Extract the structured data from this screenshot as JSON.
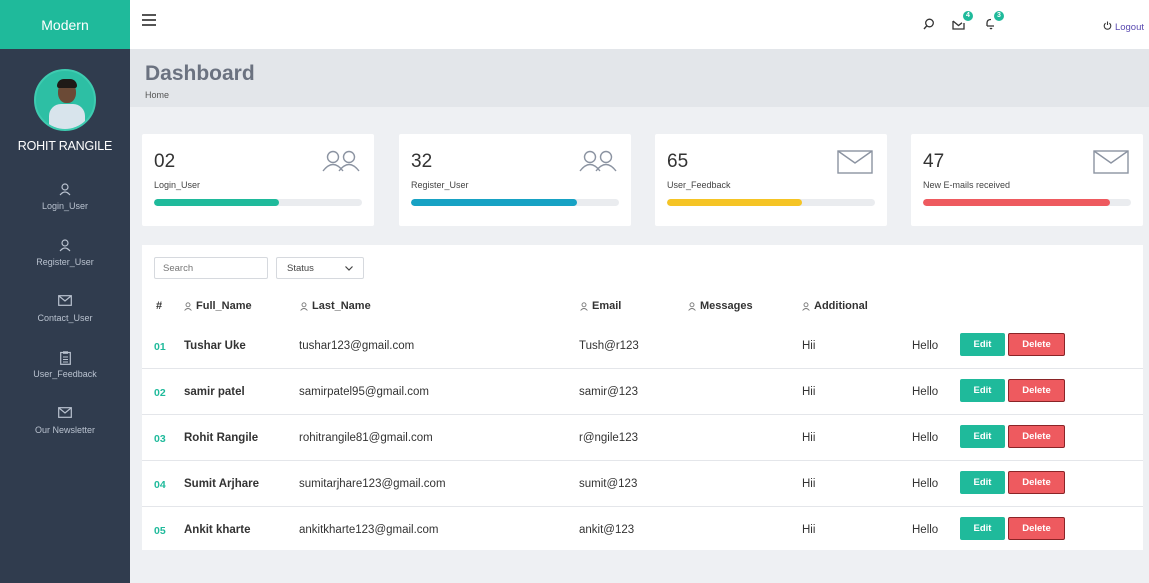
{
  "brand": "Modern",
  "user": {
    "name": "ROHIT RANGILE"
  },
  "nav": [
    {
      "label": "Login_User",
      "icon": "user-icon"
    },
    {
      "label": "Register_User",
      "icon": "user-icon"
    },
    {
      "label": "Contact_User",
      "icon": "mail-icon"
    },
    {
      "label": "User_Feedback",
      "icon": "clipboard-icon"
    },
    {
      "label": "Our Newsletter",
      "icon": "mail-icon"
    }
  ],
  "topbar": {
    "mail_badge": "4",
    "bell_badge": "3",
    "logout": "Logout"
  },
  "page": {
    "title": "Dashboard",
    "breadcrumb": "Home"
  },
  "stats": [
    {
      "value": "02",
      "label": "Login_User",
      "progress": 0.6,
      "color": "#1fba9b"
    },
    {
      "value": "32",
      "label": "Register_User",
      "progress": 0.8,
      "color": "#17a2c4"
    },
    {
      "value": "65",
      "label": "User_Feedback",
      "progress": 0.65,
      "color": "#f5c425"
    },
    {
      "value": "47",
      "label": "New E-mails received",
      "progress": 0.9,
      "color": "#ee5a5f"
    }
  ],
  "table": {
    "search_placeholder": "Search",
    "status_label": "Status",
    "headers": [
      "#",
      "Full_Name",
      "Last_Name",
      "Email",
      "Messages",
      "Additional"
    ],
    "edit_label": "Edit",
    "delete_label": "Delete",
    "rows": [
      {
        "idx": "01",
        "name": "Tushar Uke",
        "email": "tushar123@gmail.com",
        "password": "Tush@r123",
        "additional": "Hii",
        "message": "Hello"
      },
      {
        "idx": "02",
        "name": "samir patel",
        "email": "samirpatel95@gmail.com",
        "password": "samir@123",
        "additional": "Hii",
        "message": "Hello"
      },
      {
        "idx": "03",
        "name": "Rohit Rangile",
        "email": "rohitrangile81@gmail.com",
        "password": "r@ngile123",
        "additional": "Hii",
        "message": "Hello"
      },
      {
        "idx": "04",
        "name": "Sumit Arjhare",
        "email": "sumitarjhare123@gmail.com",
        "password": "sumit@123",
        "additional": "Hii",
        "message": "Hello"
      },
      {
        "idx": "05",
        "name": "Ankit kharte",
        "email": "ankitkharte123@gmail.com",
        "password": "ankit@123",
        "additional": "Hii",
        "message": "Hello"
      }
    ]
  }
}
